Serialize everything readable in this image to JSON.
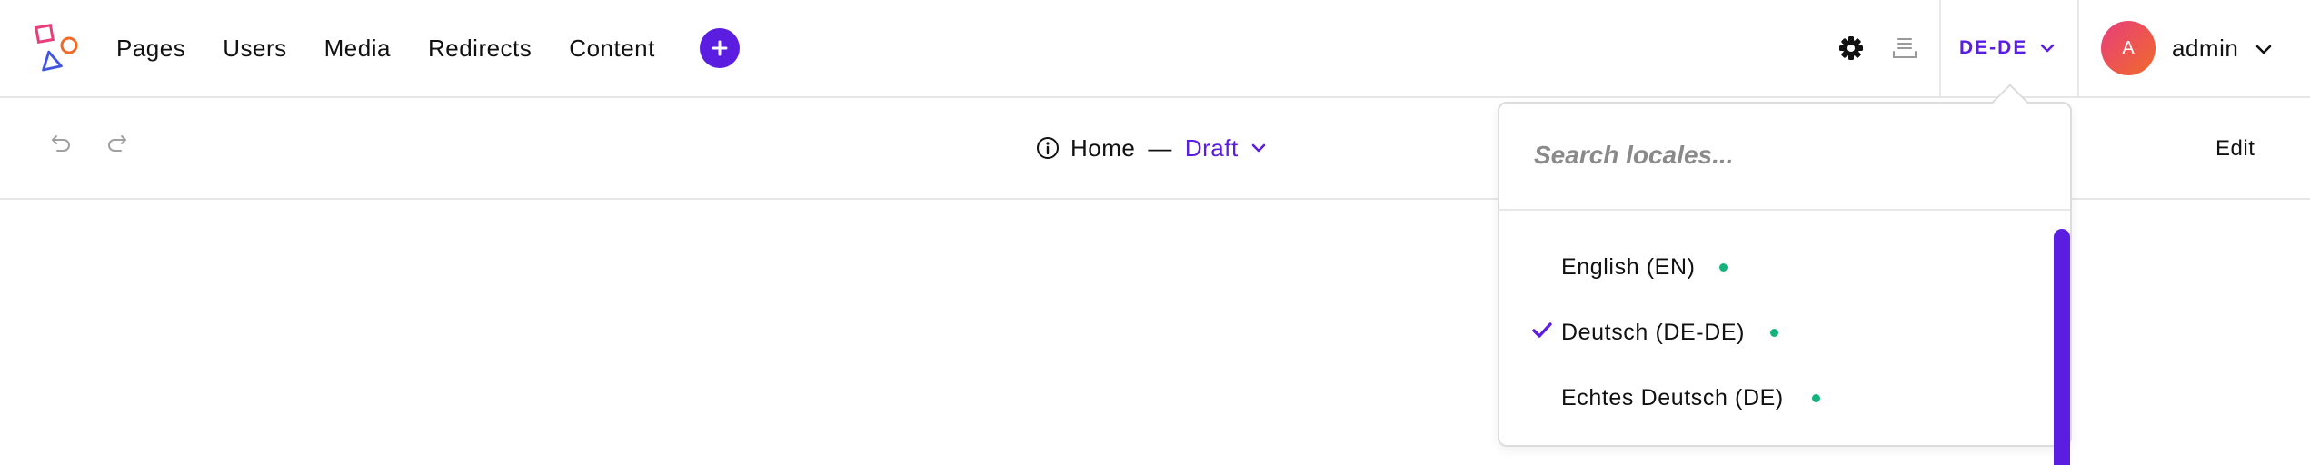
{
  "nav": {
    "items": [
      {
        "label": "Pages"
      },
      {
        "label": "Users"
      },
      {
        "label": "Media"
      },
      {
        "label": "Redirects"
      },
      {
        "label": "Content"
      }
    ],
    "add_icon": "plus-icon"
  },
  "header": {
    "settings_icon": "gear-icon",
    "queue_icon": "publish-queue-icon",
    "locale": "DE-DE",
    "user": {
      "initial": "A",
      "name": "admin"
    }
  },
  "toolbar": {
    "undo_icon": "undo-icon",
    "redo_icon": "redo-icon",
    "page_title": "Home",
    "separator": "—",
    "status": "Draft",
    "edit_label": "Edit"
  },
  "locale_dropdown": {
    "search_placeholder": "Search locales...",
    "items": [
      {
        "label": "English (EN)",
        "selected": false,
        "status": "published"
      },
      {
        "label": "Deutsch (DE-DE)",
        "selected": true,
        "status": "published"
      },
      {
        "label": "Echtes Deutsch (DE)",
        "selected": false,
        "status": "published"
      }
    ]
  },
  "colors": {
    "accent": "#5b1ee0",
    "status_dot": "#14b37d",
    "border": "#e6e6e6"
  }
}
